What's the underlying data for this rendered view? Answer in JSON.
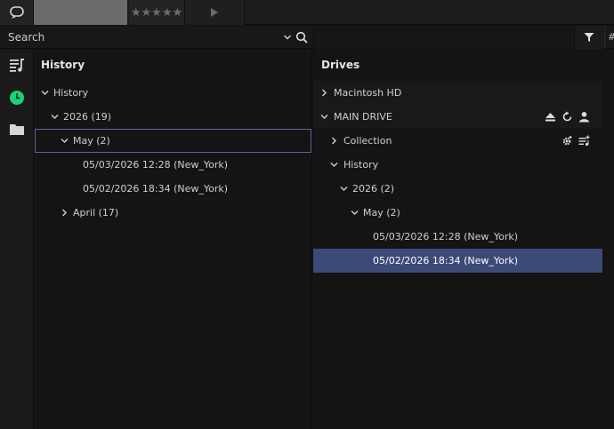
{
  "toolbar": {
    "rating_stars": "★★★★★"
  },
  "search": {
    "placeholder": "Search"
  },
  "columns": {
    "hash": "#"
  },
  "history_panel": {
    "title": "History",
    "rows": [
      {
        "label": "History"
      },
      {
        "label": "2026 (19)"
      },
      {
        "label": "May (2)"
      },
      {
        "label": "05/03/2026 12:28 (New_York)"
      },
      {
        "label": "05/02/2026 18:34 (New_York)"
      },
      {
        "label": "April (17)"
      }
    ]
  },
  "drives_panel": {
    "title": "Drives",
    "rows": [
      {
        "label": "Macintosh HD"
      },
      {
        "label": "MAIN DRIVE"
      },
      {
        "label": "Collection"
      },
      {
        "label": "History"
      },
      {
        "label": "2026 (2)"
      },
      {
        "label": "May (2)"
      },
      {
        "label": "05/03/2026 12:28 (New_York)"
      },
      {
        "label": "05/02/2026 18:34 (New_York)"
      }
    ]
  },
  "colors": {
    "accent_green": "#1ed07a",
    "selection_fill": "#3c4a78",
    "selection_outline": "#5968a0"
  }
}
